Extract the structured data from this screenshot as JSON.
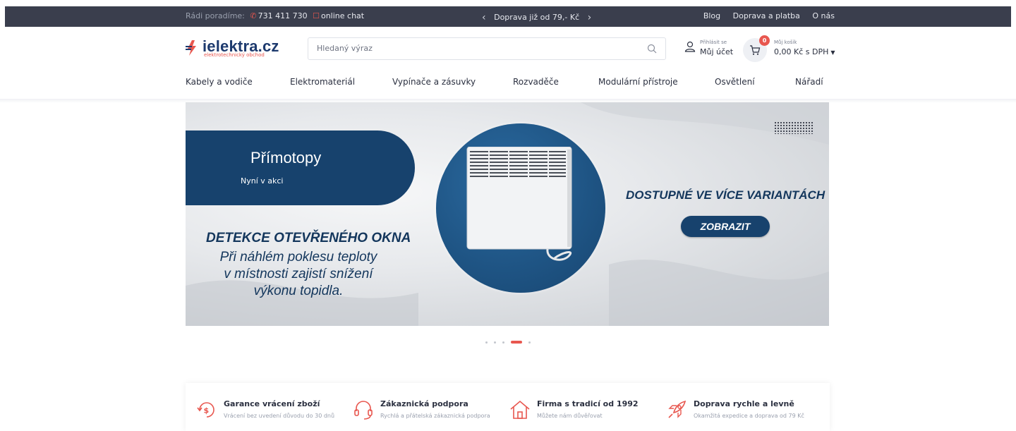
{
  "topbar": {
    "advice_label": "Rádi poradíme:",
    "phone": "731 411 730",
    "chat": "online chat",
    "promo": "Doprava již od 79,- Kč",
    "links": [
      "Blog",
      "Doprava a platba",
      "O nás"
    ]
  },
  "header": {
    "logo_text": "ielektra.cz",
    "logo_sub": "elektrotechnický obchod",
    "search_placeholder": "Hledaný výraz",
    "account_small": "Přihlásit se",
    "account_label": "Můj účet",
    "cart_count": "0",
    "cart_small": "Můj košík",
    "cart_total": "0,00 Kč s DPH"
  },
  "nav": {
    "items": [
      "Kabely a vodiče",
      "Elektromateriál",
      "Vypínače a zásuvky",
      "Rozvaděče",
      "Modulární přístroje",
      "Osvětlení",
      "Nářadí"
    ]
  },
  "banner": {
    "title": "Přímotopy",
    "subtitle": "Nyní v akci",
    "headline": "DETEKCE OTEVŘENÉHO OKNA",
    "desc_lines": [
      "Při náhlém poklesu teploty",
      "v místnosti zajistí snížení",
      "výkonu topidla."
    ],
    "right_title": "DOSTUPNÉ VE VÍCE VARIANTÁCH",
    "cta": "ZOBRAZIT",
    "slide_count": 5,
    "active_slide": 4
  },
  "features": [
    {
      "title": "Garance vrácení zboží",
      "sub": "Vrácení bez uvedení důvodu do 30 dnů",
      "icon": "money-back-icon"
    },
    {
      "title": "Zákaznická podpora",
      "sub": "Rychlá a přátelská zákaznická podpora",
      "icon": "headset-icon"
    },
    {
      "title": "Firma s tradicí od 1992",
      "sub": "Můžete nám důvěřovat",
      "icon": "house-icon"
    },
    {
      "title": "Doprava rychle a levně",
      "sub": "Okamžitá expedice a doprava od 79 Kč",
      "icon": "rocket-icon"
    }
  ],
  "colors": {
    "accent": "#e8574f",
    "brand_navy": "#17426d",
    "topbar_bg": "#3a3e4d"
  }
}
